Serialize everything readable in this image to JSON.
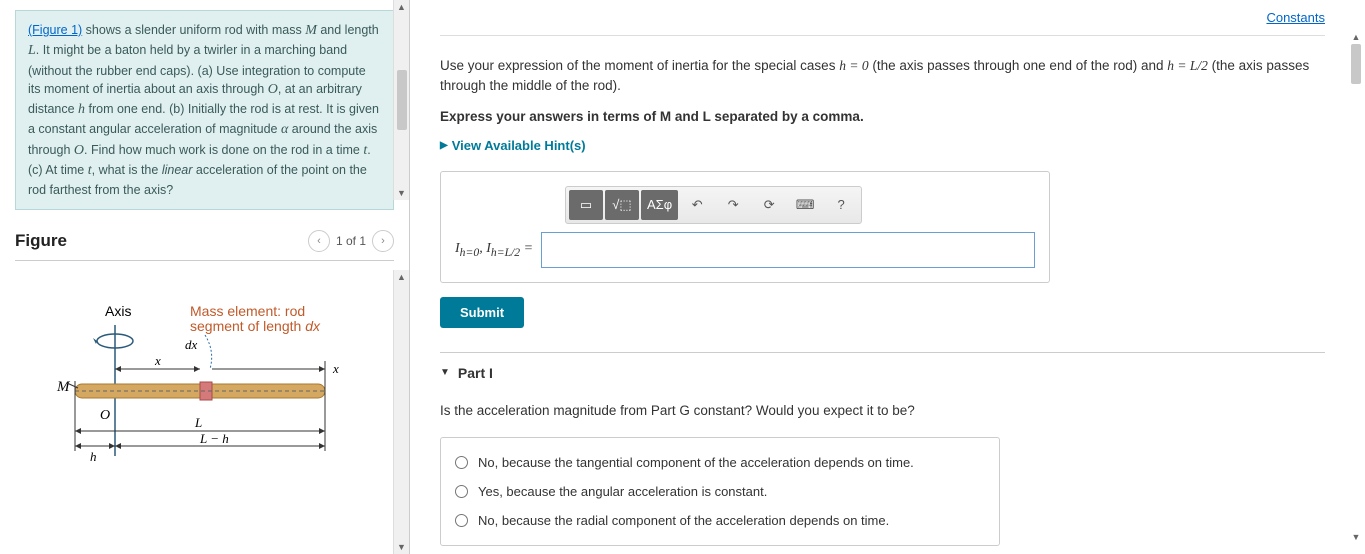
{
  "left": {
    "problem_html_parts": {
      "figure_link": "(Figure 1)",
      "body": " shows a slender uniform rod with mass M and length L. It might be a baton held by a twirler in a marching band (without the rubber end caps). (a) Use integration to compute its moment of inertia about an axis through O, at an arbitrary distance h from one end. (b) Initially the rod is at rest. It is given a constant angular acceleration of magnitude α around the axis through O. Find how much work is done on the rod in a time t. (c) At time t, what is the linear acceleration of the point on the rod farthest from the axis?"
    },
    "figure_title": "Figure",
    "pager_text": "1 of 1",
    "figure_labels": {
      "axis": "Axis",
      "mass_element": "Mass element: rod",
      "segment": "segment of length dx",
      "dx": "dx",
      "M": "M",
      "O": "O",
      "h": "h",
      "x_left": "x",
      "x_right": "x",
      "L": "L",
      "Lmh": "L − h"
    }
  },
  "right": {
    "constants": "Constants",
    "q_text_pre": "Use your expression of the moment of inertia for the special cases ",
    "q_text_h0": "h = 0",
    "q_text_mid": " (the axis passes through one end of the rod) and ",
    "q_text_hL2": "h = L/2",
    "q_text_post": " (the axis passes through the middle of the rod).",
    "q_bold_pre": "Express your answers in terms of ",
    "q_bold_M": "M",
    "q_bold_and": " and ",
    "q_bold_L": "L",
    "q_bold_post": " separated by a comma.",
    "hints": "View Available Hint(s)",
    "toolbar": {
      "template": "▭",
      "sqrt": "√⬚",
      "greek": "ΑΣφ",
      "undo": "↶",
      "redo": "↷",
      "reset": "⟳",
      "keyboard": "⌨",
      "help": "?"
    },
    "input_label": "Iₕ₌₀, Iₕ₌L/2 =",
    "submit": "Submit",
    "partI": {
      "title": "Part I",
      "question": "Is the acceleration magnitude from Part G constant? Would you expect it to be?",
      "opt1": "No, because the tangential component of the acceleration depends on time.",
      "opt2": "Yes, because the angular acceleration is constant.",
      "opt3": "No, because the radial component of the acceleration depends on time."
    }
  }
}
